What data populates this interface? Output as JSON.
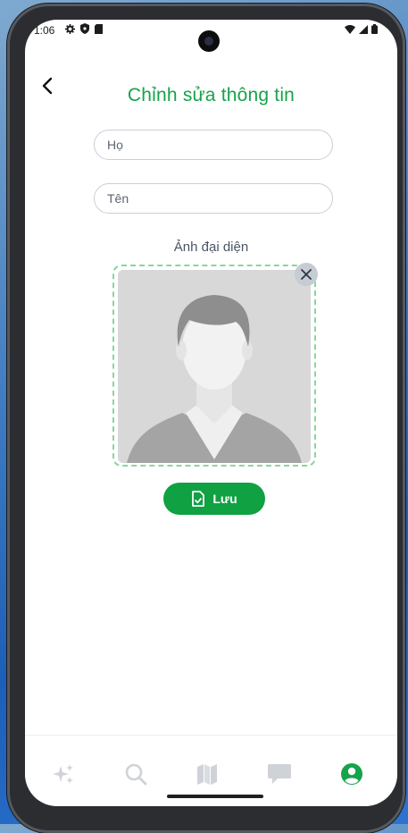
{
  "status_bar": {
    "time": "1:06",
    "left_icons": [
      "gear-icon",
      "shield-icon",
      "sd-card-icon"
    ],
    "right_icons": [
      "wifi-icon",
      "signal-icon",
      "battery-icon"
    ]
  },
  "header": {
    "title": "Chỉnh sửa thông tin",
    "back_icon": "chevron-left-icon"
  },
  "form": {
    "last_name": {
      "placeholder": "Họ",
      "value": ""
    },
    "first_name": {
      "placeholder": "Tên",
      "value": ""
    },
    "avatar_label": "Ảnh đại diện",
    "avatar_icon": "person-silhouette",
    "remove_icon": "close-icon",
    "save_label": "Lưu",
    "save_icon": "file-check-icon"
  },
  "bottom_nav": {
    "items": [
      {
        "icon": "sparkles-icon",
        "active": false
      },
      {
        "icon": "search-icon",
        "active": false
      },
      {
        "icon": "map-icon",
        "active": false
      },
      {
        "icon": "chat-icon",
        "active": false
      },
      {
        "icon": "user-circle-icon",
        "active": true
      }
    ]
  },
  "colors": {
    "accent": "#16a34a",
    "button": "#0fa142",
    "inactive_icon": "#cfd3d8",
    "dashed_border": "#86d89a"
  }
}
